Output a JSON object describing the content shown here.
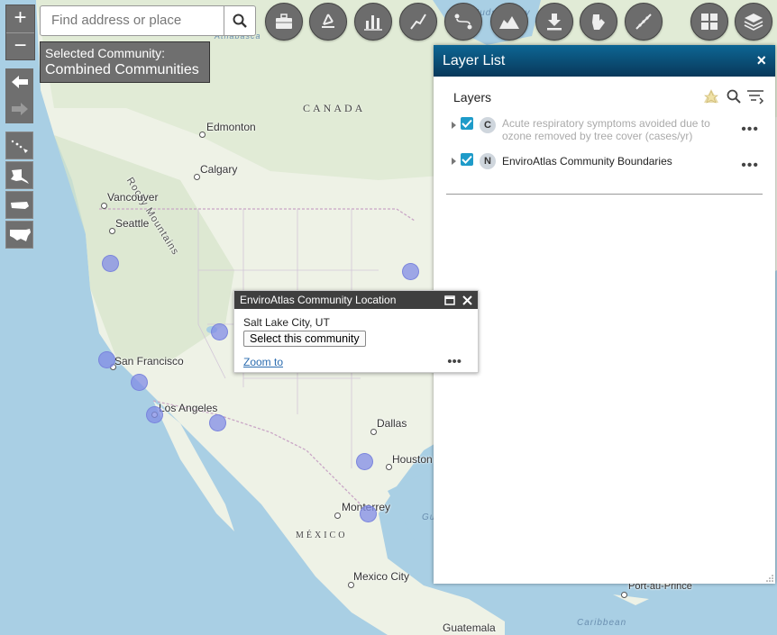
{
  "search": {
    "placeholder": "Find address or place"
  },
  "selected_community": {
    "line1": "Selected Community:",
    "line2": "Combined Communities"
  },
  "map": {
    "countries": [
      {
        "id": "canada",
        "label": "CANADA"
      },
      {
        "id": "mexico",
        "label": "MÉXICO"
      }
    ],
    "cities": [
      {
        "id": "edmonton",
        "label": "Edmonton"
      },
      {
        "id": "calgary",
        "label": "Calgary"
      },
      {
        "id": "vancouver",
        "label": "Vancouver"
      },
      {
        "id": "seattle",
        "label": "Seattle"
      },
      {
        "id": "san-francisco",
        "label": "San Francisco"
      },
      {
        "id": "los-angeles",
        "label": "Los Angeles"
      },
      {
        "id": "dallas",
        "label": "Dallas"
      },
      {
        "id": "houston",
        "label": "Houston"
      },
      {
        "id": "monterrey",
        "label": "Monterrey"
      },
      {
        "id": "mexico-city",
        "label": "Mexico City"
      },
      {
        "id": "guatemala",
        "label": "Guatemala"
      },
      {
        "id": "port-au-prince",
        "label": "Port-au-Prince"
      }
    ],
    "features": [
      {
        "id": "rocky-mountains",
        "label": "Rocky Mountains"
      },
      {
        "id": "hudson-bay",
        "label": "Hudson Bay"
      },
      {
        "id": "athabasca",
        "label": "Athabasca"
      },
      {
        "id": "caribbean",
        "label": "Caribbean"
      },
      {
        "id": "gulf",
        "label": "Gu"
      }
    ]
  },
  "layer_list": {
    "title": "Layer List",
    "close": "×",
    "section_label": "Layers",
    "layers": [
      {
        "badge": "C",
        "name": "Acute respiratory symptoms avoided due to ozone removed by tree cover (cases/yr)",
        "checked": true,
        "dimmed": true
      },
      {
        "badge": "N",
        "name": "EnviroAtlas Community Boundaries",
        "checked": true,
        "dimmed": false
      }
    ],
    "more": "•••"
  },
  "popup": {
    "title": "EnviroAtlas Community Location",
    "city": "Salt Lake City, UT",
    "select_label": "Select this community",
    "zoom_label": "Zoom to",
    "more": "•••"
  },
  "colors": {
    "panel_header": "#08385a",
    "community_dot": "#8c8ce6",
    "toolbar": "#6c6c6c",
    "checkbox": "#1e9bc9"
  },
  "toolbar_icons": [
    "briefcase-icon",
    "recycle-icon",
    "bar-chart-icon",
    "line-draw-icon",
    "route-icon",
    "elevation-profile-icon",
    "download-icon",
    "bookmark-hand-icon",
    "timeline-icon",
    "basemap-grid-icon",
    "layers-icon"
  ]
}
